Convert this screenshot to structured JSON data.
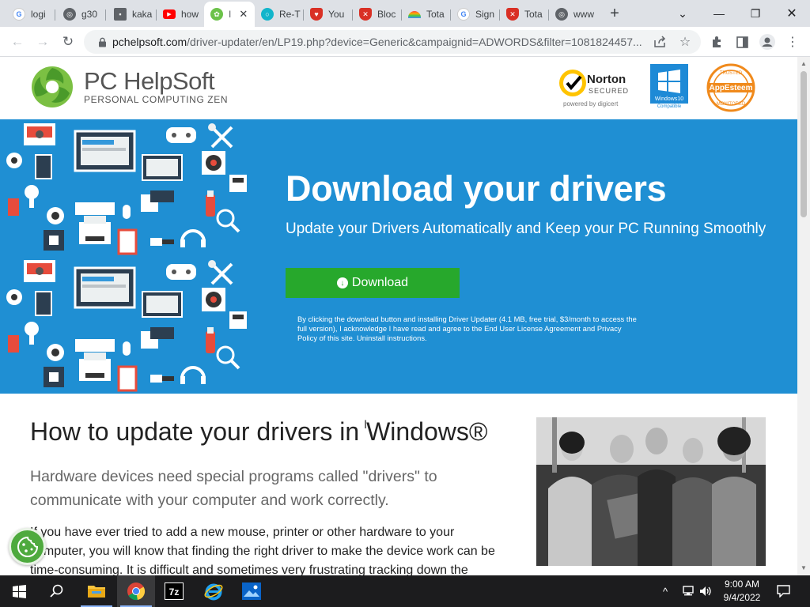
{
  "browser": {
    "tabs": [
      {
        "label": "logi",
        "icon": "google-icon"
      },
      {
        "label": "g30",
        "icon": "globe-icon"
      },
      {
        "label": "kaka",
        "icon": "page-icon"
      },
      {
        "label": "how",
        "icon": "youtube-icon"
      },
      {
        "label": "I",
        "icon": "pchelpsoft-icon",
        "active": true
      },
      {
        "label": "Re-T",
        "icon": "chrome-ring-icon"
      },
      {
        "label": "You",
        "icon": "shield-icon"
      },
      {
        "label": "Bloc",
        "icon": "shield-x-icon"
      },
      {
        "label": "Tota",
        "icon": "rainbow-icon"
      },
      {
        "label": "Sign",
        "icon": "google-icon"
      },
      {
        "label": "Tota",
        "icon": "shield-x-icon"
      },
      {
        "label": "www",
        "icon": "globe-icon"
      }
    ],
    "url_host": "pchelpsoft.com",
    "url_path": "/driver-updater/en/LP19.php?device=Generic&campaignid=ADWORDS&filter=1081824457..."
  },
  "site": {
    "logo_name": "PC HelpSoft",
    "logo_tagline": "PERSONAL COMPUTING ZEN",
    "badges": {
      "norton_title": "Norton",
      "norton_sub": "SECURED",
      "norton_powered": "powered by digicert",
      "windows_line1": "Windows10",
      "windows_line2": "Compatible",
      "appesteem_top": "TRUSTED",
      "appesteem_name": "AppEsteem",
      "appesteem_bottom": "MONITORED"
    }
  },
  "hero": {
    "title": "Download your drivers",
    "subtitle": "Update your Drivers Automatically and Keep your PC Running Smoothly",
    "download_label": "Download",
    "legal": "By clicking the download button and installing Driver Updater (4.1 MB, free trial, $3/month to access the full version), I acknowledge I have read and agree to the End User License Agreement and Privacy Policy of this site. Uninstall instructions."
  },
  "content": {
    "heading": "How to update your drivers in Windows®",
    "lead": "Hardware devices need special programs called \"drivers\" to communicate with your computer and work correctly.",
    "paragraph": "If you have ever tried to add a new mouse, printer or other hardware to your computer, you will know that finding the right driver to make the device work can be time-consuming. It is difficult and sometimes very frustrating tracking down the"
  },
  "taskbar": {
    "time": "9:00 AM",
    "date": "9/4/2022",
    "apps": [
      "file-explorer-icon",
      "chrome-icon",
      "7zip-icon",
      "internet-explorer-icon",
      "photos-icon"
    ]
  },
  "colors": {
    "hero_bg": "#1f8fd3",
    "download_green": "#27a82c",
    "cookie_green": "#4eaa3e"
  }
}
